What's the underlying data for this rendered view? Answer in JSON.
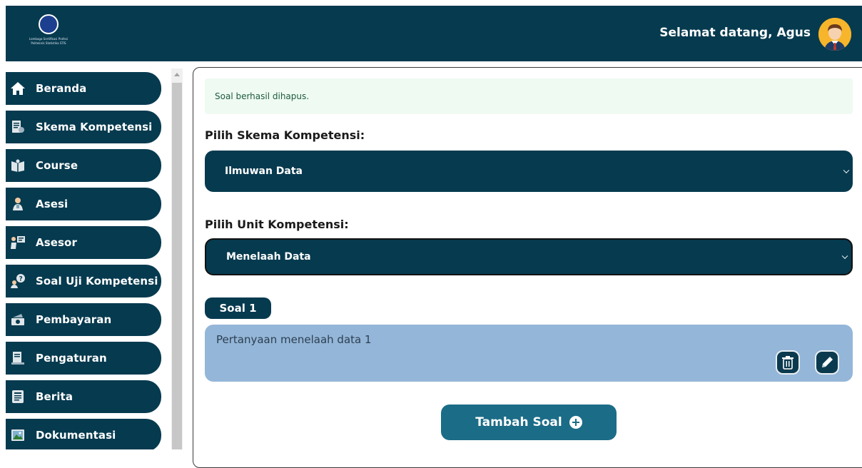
{
  "header": {
    "logo_text": "Lembaga Sertifikasi Profesi Politeknik Statistika STIS",
    "welcome": "Selamat datang, Agus"
  },
  "sidebar": {
    "items": [
      {
        "label": "Beranda",
        "icon": "home-icon"
      },
      {
        "label": "Skema Kompetensi",
        "icon": "document-icon"
      },
      {
        "label": "Course",
        "icon": "book-icon"
      },
      {
        "label": "Asesi",
        "icon": "person-icon"
      },
      {
        "label": "Asesor",
        "icon": "teacher-icon"
      },
      {
        "label": "Soal Uji Kompetensi",
        "icon": "question-icon"
      },
      {
        "label": "Pembayaran",
        "icon": "money-icon"
      },
      {
        "label": "Pengaturan",
        "icon": "settings-icon"
      },
      {
        "label": "Berita",
        "icon": "news-icon"
      },
      {
        "label": "Dokumentasi",
        "icon": "image-icon"
      }
    ]
  },
  "main": {
    "alert": "Soal berhasil dihapus.",
    "skema_label": "Pilih Skema Kompetensi:",
    "skema_value": "Ilmuwan Data",
    "unit_label": "Pilih Unit Kompetensi:",
    "unit_value": "Menelaah Data",
    "soal_tag": "Soal 1",
    "soal_text": "Pertanyaan menelaah data 1",
    "add_button": "Tambah Soal"
  },
  "colors": {
    "primary": "#063a4f",
    "accent": "#1b6c87",
    "soal_box": "#94b6d8",
    "alert_bg": "#eefaf2"
  }
}
